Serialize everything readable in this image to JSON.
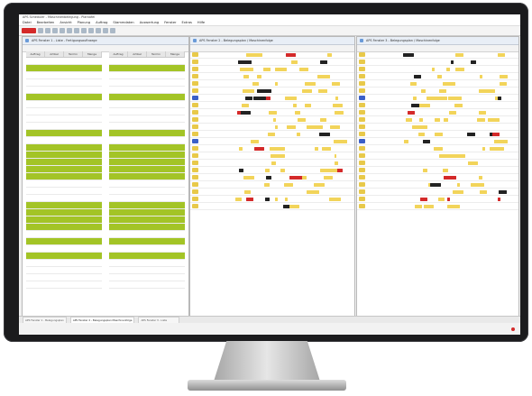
{
  "app": {
    "title": "APS Scheduler - Maschinenbelegung - Plantafel"
  },
  "menu": [
    "Datei",
    "Bearbeiten",
    "Ansicht",
    "Planung",
    "Auftrag",
    "Stammdaten",
    "Auswertung",
    "Fenster",
    "Extras",
    "Hilfe"
  ],
  "panes": [
    {
      "title": "APS Fenster 1 - Liste - Fertigungsauftraege"
    },
    {
      "title": "APS Fenster 2 - Belegungsplan / Maschinenfolge"
    },
    {
      "title": "APS Fenster 3 - Belegungsplan / Maschinenfolge"
    }
  ],
  "list": {
    "headers": [
      "Auftrag",
      "Artikel",
      "Termin",
      "Menge"
    ],
    "rows_pattern": [
      "w",
      "g",
      "w",
      "w",
      "w",
      "g",
      "w",
      "w",
      "w",
      "w",
      "g",
      "w",
      "g",
      "g",
      "g",
      "g",
      "g",
      "w",
      "w",
      "w",
      "g",
      "g",
      "g",
      "g",
      "w",
      "g",
      "w",
      "g",
      "w",
      "w",
      "w",
      "w"
    ]
  },
  "status_tabs": [
    "APS Fenster 1 - Belegungsplan",
    "APS Fenster 2 - Belegungsplan Maschinenfolge",
    "APS Fenster 3 - Liste"
  ],
  "colors": {
    "accent_red": "#d42a2a",
    "row_green": "#a3c426",
    "bar_yellow": "#f2d45a",
    "bar_black": "#222222"
  }
}
